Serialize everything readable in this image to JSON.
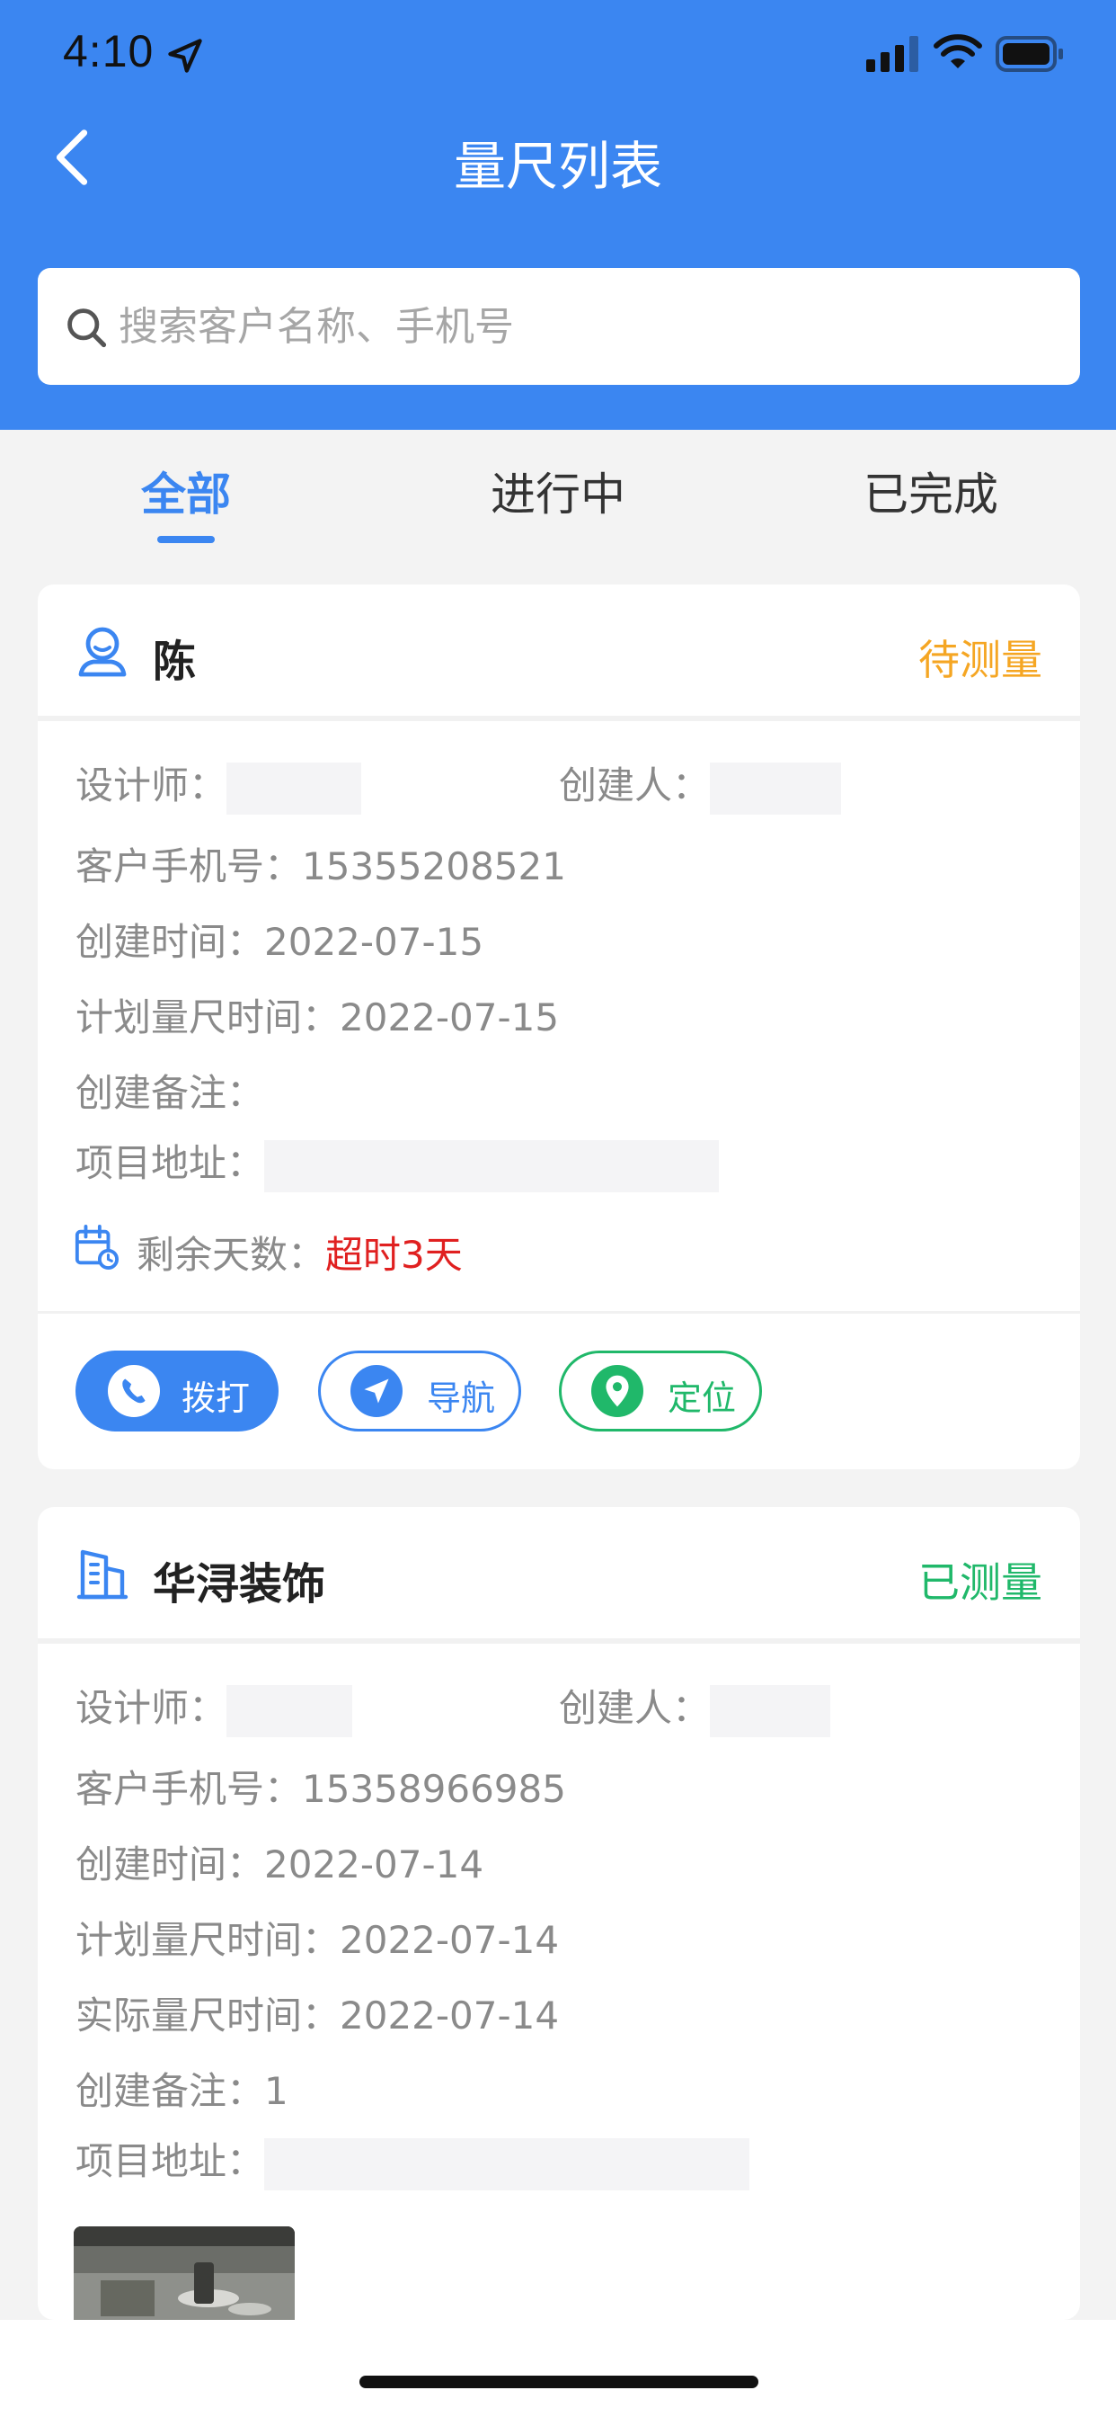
{
  "status_bar": {
    "time": "4:10"
  },
  "nav": {
    "title": "量尺列表"
  },
  "search": {
    "placeholder": "搜索客户名称、手机号"
  },
  "tabs": [
    {
      "label": "全部",
      "active": true
    },
    {
      "label": "进行中",
      "active": false
    },
    {
      "label": "已完成",
      "active": false
    }
  ],
  "cards": [
    {
      "name": "陈",
      "icon": "person-icon",
      "status": "待测量",
      "status_color": "#f5a623",
      "designer_label": "设计师：",
      "creator_label": "创建人：",
      "phone_label": "客户手机号：",
      "phone": "15355208521",
      "created_label": "创建时间：",
      "created": "2022-07-15",
      "plan_label": "计划量尺时间：",
      "plan": "2022-07-15",
      "note_label": "创建备注：",
      "note": "",
      "address_label": "项目地址：",
      "remain_label": "剩余天数：",
      "remain": "超时3天",
      "actions": {
        "call": "拨打",
        "navigate": "导航",
        "locate": "定位"
      }
    },
    {
      "name": "华浔装饰",
      "icon": "building-icon",
      "status": "已测量",
      "status_color": "#20b86a",
      "designer_label": "设计师：",
      "creator_label": "创建人：",
      "phone_label": "客户手机号：",
      "phone": "15358966985",
      "created_label": "创建时间：",
      "created": "2022-07-14",
      "plan_label": "计划量尺时间：",
      "plan": "2022-07-14",
      "actual_label": "实际量尺时间：",
      "actual": "2022-07-14",
      "note_label": "创建备注：",
      "note": "1",
      "address_label": "项目地址："
    }
  ],
  "colors": {
    "primary": "#3b86f1",
    "danger": "#e02020",
    "success": "#20b86a",
    "warning": "#f5a623"
  }
}
